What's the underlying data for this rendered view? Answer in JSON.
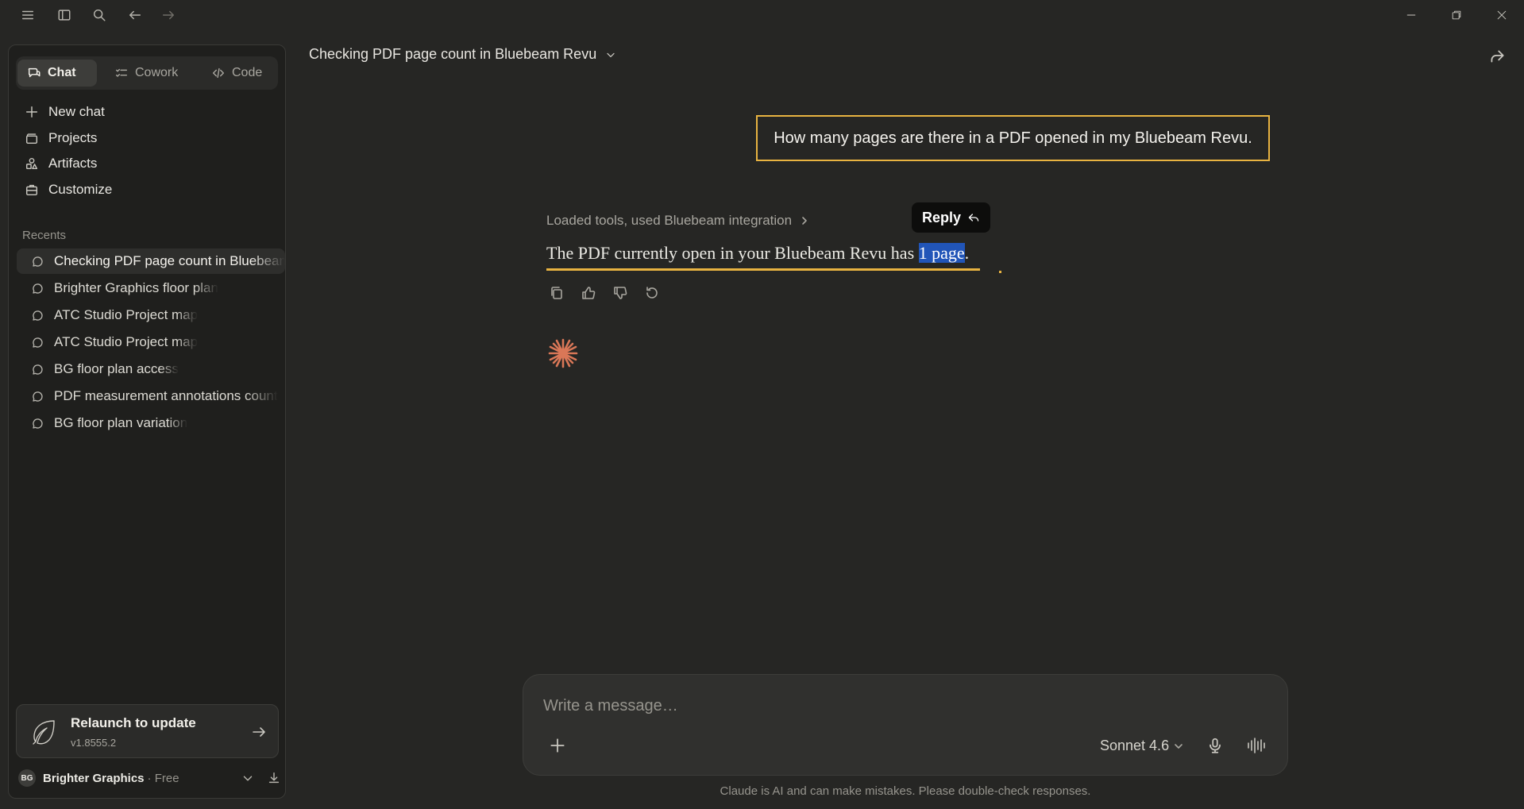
{
  "toolbar": {
    "menu_icon": "hamburger-icon",
    "sidebar_icon": "sidebar-toggle-icon",
    "search_icon": "search-icon",
    "back_icon": "arrow-left-icon",
    "forward_icon": "arrow-right-icon"
  },
  "window_controls": [
    "minimize-icon",
    "restore-icon",
    "close-icon"
  ],
  "sidebar": {
    "modes": [
      {
        "label": "Chat",
        "icon": "chat-bubbles-icon",
        "active": true
      },
      {
        "label": "Cowork",
        "icon": "checklist-icon",
        "active": false
      },
      {
        "label": "Code",
        "icon": "code-icon",
        "active": false
      }
    ],
    "nav": [
      {
        "label": "New chat",
        "icon": "plus-icon"
      },
      {
        "label": "Projects",
        "icon": "folder-stack-icon"
      },
      {
        "label": "Artifacts",
        "icon": "shapes-icon"
      },
      {
        "label": "Customize",
        "icon": "briefcase-icon"
      }
    ],
    "recents_label": "Recents",
    "recents": [
      {
        "label": "Checking PDF page count in Bluebeam Revu",
        "active": true
      },
      {
        "label": "Brighter Graphics floor plan",
        "active": false
      },
      {
        "label": "ATC Studio Project map",
        "active": false
      },
      {
        "label": "ATC Studio Project map",
        "active": false
      },
      {
        "label": "BG floor plan access",
        "active": false
      },
      {
        "label": "PDF measurement annotations count",
        "active": false
      },
      {
        "label": "BG floor plan variation",
        "active": false
      }
    ],
    "update": {
      "title": "Relaunch to update",
      "version": "v1.8555.2",
      "icon": "leaf-icon"
    },
    "user": {
      "initials": "BG",
      "name": "Brighter Graphics",
      "plan": "· Free"
    }
  },
  "conversation": {
    "title": "Checking PDF page count in Bluebeam Revu",
    "user_message": "How many pages are there in a PDF opened in my Bluebeam Revu.",
    "tools_summary": "Loaded tools, used Bluebeam integration",
    "reply_label": "Reply",
    "answer_before": "The PDF currently open in your Bluebeam Revu has ",
    "answer_highlight": "1 page",
    "answer_after": ".",
    "actions": [
      "copy-icon",
      "thumbs-up-icon",
      "thumbs-down-icon",
      "retry-icon"
    ]
  },
  "composer": {
    "placeholder": "Write a message…",
    "model": "Sonnet 4.6"
  },
  "footer": {
    "disclaimer": "Claude is AI and can make mistakes. Please double-check responses."
  },
  "colors": {
    "background": "#262624",
    "sidebar": "#1f1f1d",
    "highlight_border": "#e8b341",
    "selection": "#2155b8",
    "accent_spark": "#d97757"
  }
}
